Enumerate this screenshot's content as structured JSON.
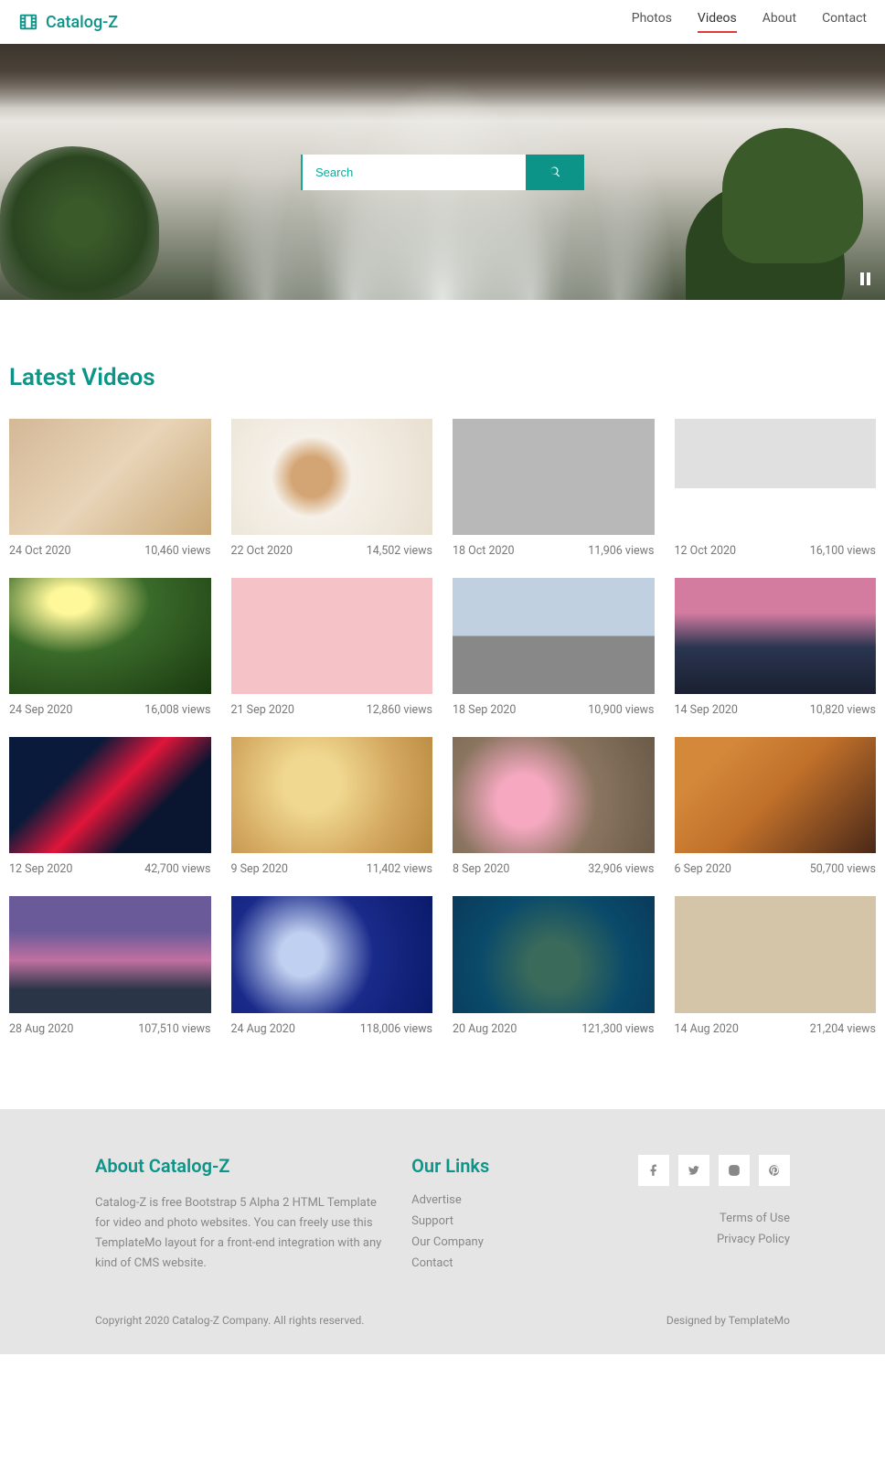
{
  "brand": "Catalog-Z",
  "nav": {
    "items": [
      {
        "label": "Photos",
        "active": false
      },
      {
        "label": "Videos",
        "active": true
      },
      {
        "label": "About",
        "active": false
      },
      {
        "label": "Contact",
        "active": false
      }
    ]
  },
  "search": {
    "placeholder": "Search"
  },
  "section_title": "Latest Videos",
  "videos": [
    {
      "date": "24 Oct 2020",
      "views": "10,460 views"
    },
    {
      "date": "22 Oct 2020",
      "views": "14,502 views"
    },
    {
      "date": "18 Oct 2020",
      "views": "11,906 views"
    },
    {
      "date": "12 Oct 2020",
      "views": "16,100 views"
    },
    {
      "date": "24 Sep 2020",
      "views": "16,008 views"
    },
    {
      "date": "21 Sep 2020",
      "views": "12,860 views"
    },
    {
      "date": "18 Sep 2020",
      "views": "10,900 views"
    },
    {
      "date": "14 Sep 2020",
      "views": "10,820 views"
    },
    {
      "date": "12 Sep 2020",
      "views": "42,700 views"
    },
    {
      "date": "9 Sep 2020",
      "views": "11,402 views"
    },
    {
      "date": "8 Sep 2020",
      "views": "32,906 views"
    },
    {
      "date": "6 Sep 2020",
      "views": "50,700 views"
    },
    {
      "date": "28 Aug 2020",
      "views": "107,510 views"
    },
    {
      "date": "24 Aug 2020",
      "views": "118,006 views"
    },
    {
      "date": "20 Aug 2020",
      "views": "121,300 views"
    },
    {
      "date": "14 Aug 2020",
      "views": "21,204 views"
    }
  ],
  "footer": {
    "about_title": "About Catalog-Z",
    "about_text": "Catalog-Z is free Bootstrap 5 Alpha 2 HTML Template for video and photo websites. You can freely use this TemplateMo layout for a front-end integration with any kind of CMS website.",
    "links_title": "Our Links",
    "links": [
      "Advertise",
      "Support",
      "Our Company",
      "Contact"
    ],
    "legal": [
      "Terms of Use",
      "Privacy Policy"
    ],
    "copyright": "Copyright 2020 Catalog-Z Company. All rights reserved.",
    "designed": "Designed by TemplateMo"
  }
}
